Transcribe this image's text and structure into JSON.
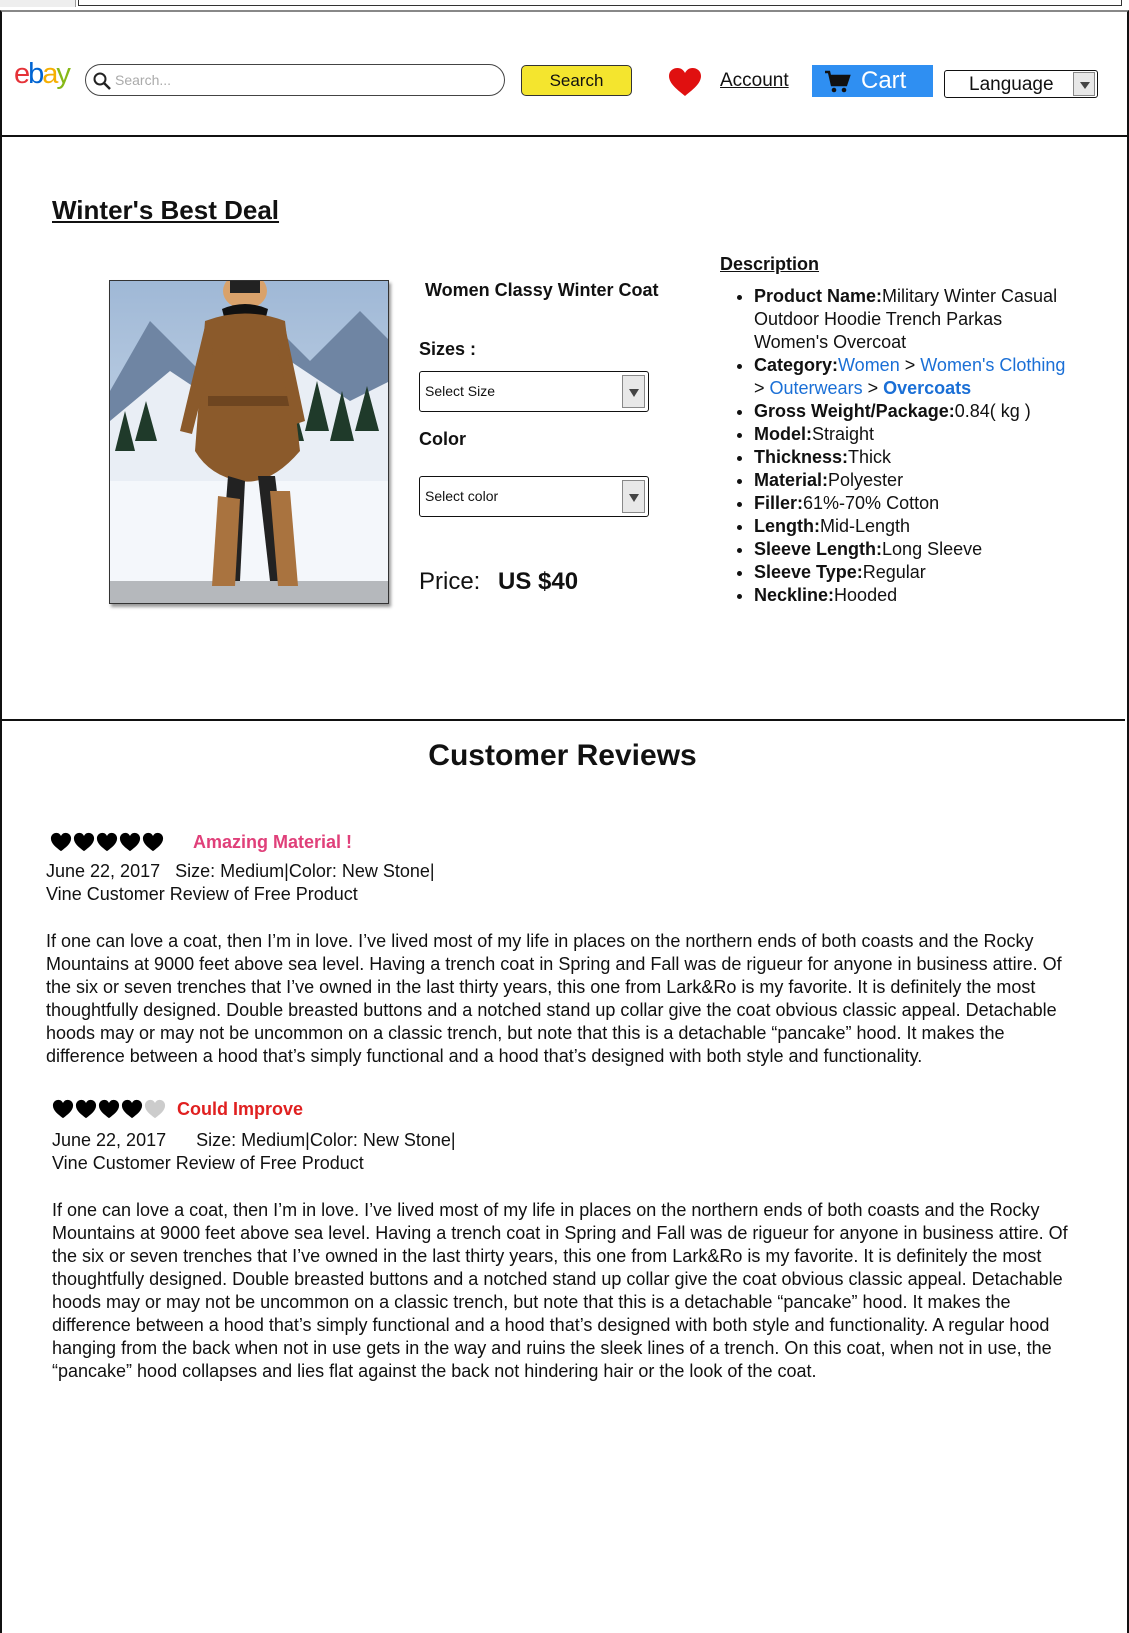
{
  "header": {
    "logo": {
      "e": "e",
      "b": "b",
      "a": "a",
      "y": "y"
    },
    "search_placeholder": "Search...",
    "search_button": "Search",
    "account_link": "Account",
    "cart_button": "Cart",
    "language_select": "Language",
    "colors": {
      "search_button": "#f4e52e",
      "cart": "#2f8ff2",
      "heart": "#e01010"
    }
  },
  "product": {
    "section_title": "Winter's Best Deal",
    "name": "Women Classy Winter Coat",
    "sizes_label": "Sizes :",
    "size_select": "Select Size",
    "color_label": "Color",
    "color_select": "Select color",
    "price_label": "Price:",
    "price_value": "US $40"
  },
  "description": {
    "title": "Description",
    "items": [
      {
        "key": "Product Name:",
        "value": "Military Winter Casual Outdoor Hoodie Trench Parkas Women's Overcoat"
      },
      {
        "key": "Category:",
        "crumbs": [
          "Women",
          "Women's Clothing",
          "Outerwears",
          "Overcoats"
        ],
        "sep": ">"
      },
      {
        "key": "Gross Weight/Package:",
        "value": "0.84( kg )"
      },
      {
        "key": "Model:",
        "value": "Straight"
      },
      {
        "key": "Thickness:",
        "value": "Thick"
      },
      {
        "key": "Material:",
        "value": "Polyester"
      },
      {
        "key": "Filler:",
        "value": "61%-70% Cotton"
      },
      {
        "key": "Length:",
        "value": "Mid-Length"
      },
      {
        "key": "Sleeve Length:",
        "value": "Long Sleeve"
      },
      {
        "key": "Sleeve Type:",
        "value": "Regular"
      },
      {
        "key": "Neckline:",
        "value": "Hooded"
      }
    ]
  },
  "reviews": {
    "title": "Customer Reviews",
    "items": [
      {
        "rating": 5,
        "headline": "Amazing Material !",
        "date": "June 22, 2017",
        "details": "Size: Medium|Color: New Stone|",
        "vine": "Vine Customer Review of Free Product",
        "body": "If one can love a coat, then I’m in love. I’ve lived most of my life in places on the northern ends of both coasts and the Rocky Mountains at 9000 feet above sea level. Having a trench coat in Spring and Fall was de rigueur for anyone in business attire. Of the six or seven trenches that I’ve owned in the last thirty years, this one from Lark&Ro is my favorite. It is definitely the most thoughtfully designed. Double breasted buttons and a notched stand up collar give the coat obvious classic appeal. Detachable hoods may or may not be uncommon on a classic trench, but note that this is a detachable “pancake” hood. It makes the difference between a hood that’s simply functional and a hood that’s designed with both style and functionality."
      },
      {
        "rating": 4,
        "headline": "Could Improve",
        "date": "June 22, 2017",
        "details": "Size: Medium|Color: New Stone|",
        "vine": "Vine Customer Review of Free Product",
        "body": "If one can love a coat, then I’m in love. I’ve lived most of my life in places on the northern ends of both coasts and the Rocky Mountains at 9000 feet above sea level. Having a trench coat in Spring and Fall was de rigueur for anyone in business attire. Of the six or seven trenches that I’ve owned in the last thirty years, this one from Lark&Ro is my favorite. It is definitely the most thoughtfully designed. Double breasted buttons and a notched stand up collar give the coat obvious classic appeal. Detachable hoods may or may not be uncommon on a classic trench, but note that this is a detachable “pancake” hood. It makes the difference between a hood that’s simply functional and a hood that’s designed with both style and functionality. A regular hood hanging from the back when not in use gets in the way and ruins the sleek lines of a trench. On this coat, when not in use, the “pancake” hood collapses and lies flat against the back not hindering hair or the look of the coat."
      }
    ],
    "colors": {
      "heart_filled": "#000000",
      "heart_empty": "#cccccc",
      "headline_1": "#e0407a",
      "headline_2": "#e02020"
    }
  }
}
